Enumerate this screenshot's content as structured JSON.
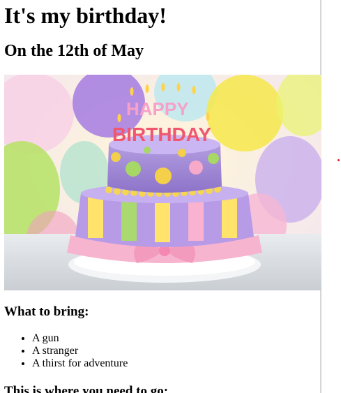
{
  "page": {
    "title": "It's my birthday!",
    "subtitle": "On the 12th of May"
  },
  "hero_image": {
    "alt": "birthday-cake-photo",
    "candle_text_top": "HAPPY",
    "candle_text_bottom": "BIRTHDAY"
  },
  "bring": {
    "heading": "What to bring:",
    "items": [
      "A gun",
      "A stranger",
      "A thirst for adventure"
    ]
  },
  "location": {
    "heading": "This is where you need to go:"
  },
  "colors": {
    "scroll_border": "#d6d6d6",
    "marker_dot": "#e0202a"
  }
}
